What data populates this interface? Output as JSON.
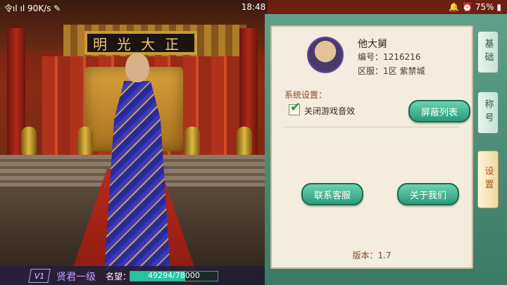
{
  "status_bar": {
    "left": "令ıl ıl 90K/s ✎",
    "time": "18:48",
    "battery": "75%"
  },
  "scene": {
    "plaque": "明光大正"
  },
  "player": {
    "name": "他大舅",
    "id_line": "编号：1216216",
    "server_line": "区服：1区 紫禁城"
  },
  "settings": {
    "section_label": "系统设置：",
    "mute_label": "关闭游戏音效",
    "mute_checked": true,
    "block_list_button": "屏蔽列表",
    "contact_button": "联系客服",
    "about_button": "关于我们",
    "version": "版本：1.7"
  },
  "tabs": [
    "基础",
    "称号",
    "设置"
  ],
  "bottom_bar": {
    "vip": "V1",
    "rank": "贤君一级",
    "fame_label": "名望：",
    "fame_text": "49294/78000",
    "fame_current": 49294,
    "fame_max": 78000
  },
  "colors": {
    "accent": "#2a9a7a",
    "panel_bg": "#f3ecdf",
    "rank": "#c6a0ff"
  }
}
